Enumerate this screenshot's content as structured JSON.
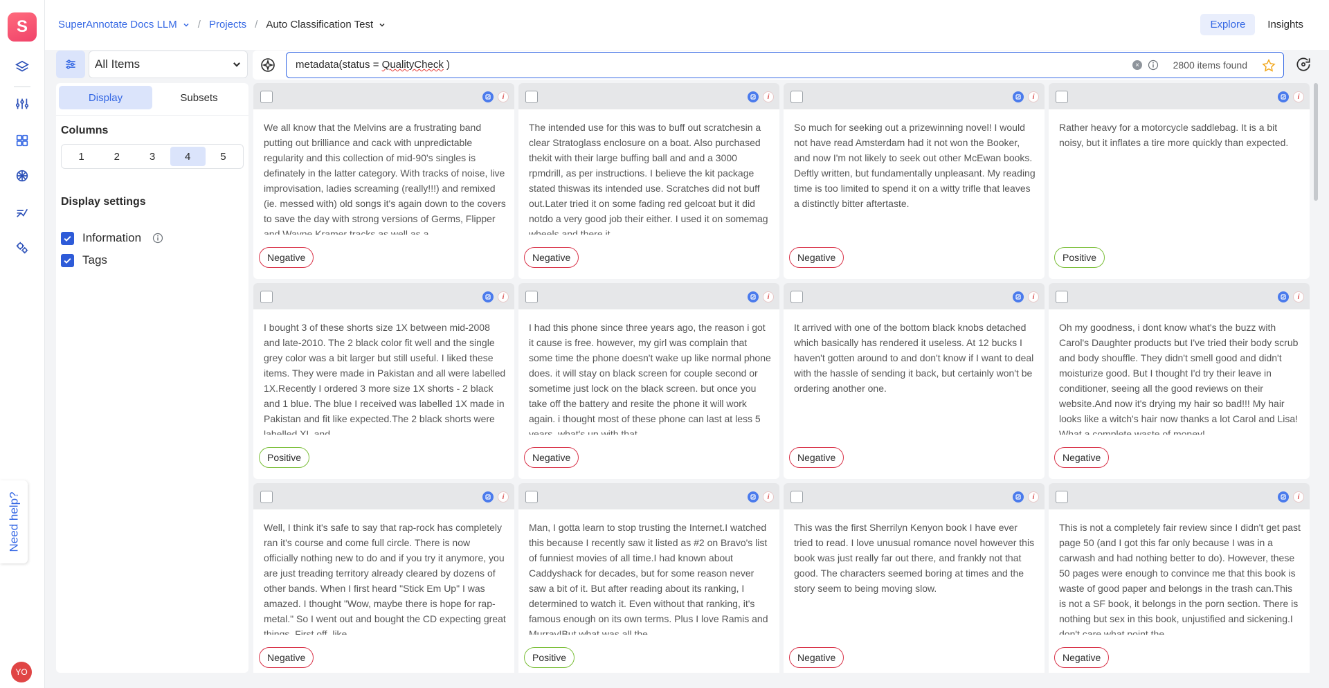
{
  "app": {
    "logo_letter": "S",
    "avatar_initials": "YO",
    "need_help": "Need help?"
  },
  "breadcrumb": {
    "team": "SuperAnnotate Docs LLM",
    "projects": "Projects",
    "project": "Auto Classification Test"
  },
  "top_tabs": {
    "explore": "Explore",
    "insights": "Insights"
  },
  "filter": {
    "selected": "All Items"
  },
  "query": {
    "prefix": "metadata(status = ",
    "misspelled": "QualityCheck",
    "suffix": " )",
    "count": "2800 items found"
  },
  "panel": {
    "tab_display": "Display",
    "tab_subsets": "Subsets",
    "columns_label": "Columns",
    "columns": [
      "1",
      "2",
      "3",
      "4",
      "5"
    ],
    "selected_columns": "4",
    "display_settings_label": "Display settings",
    "information_label": "Information",
    "tags_label": "Tags"
  },
  "colors": {
    "accent": "#3467e4",
    "negative": "#d9344a",
    "positive": "#7cbf3a"
  },
  "cards": [
    {
      "text": "We all know that the Melvins are a frustrating band putting out brilliance and cack with unpredictable regularity and this collection of mid-90's singles is definately in the latter category. With tracks of noise, live improvisation, ladies screaming (really!!!) and remixed (ie. messed with) old songs it's again down to the covers to save the day with strong versions of Germs, Flipper and Wayne Kramer tracks as well as a",
      "tag": "Negative",
      "sentiment": "negative"
    },
    {
      "text": "The intended use for this was to buff out scratchesin a clear Stratoglass enclosure on a boat. Also purchased thekit with their large buffing ball and and a 3000 rpmdrill, as per instructions. I believe the kit package stated thiswas its intended use. Scratches did not buff out.Later tried it on some fading red gelcoat but it did notdo a very good job their either. I used it on somemag wheels and there it",
      "tag": "Negative",
      "sentiment": "negative"
    },
    {
      "text": "So much for seeking out a prizewinning novel! I would not have read Amsterdam had it not won the Booker, and now I'm not likely to seek out other McEwan books. Deftly written, but fundamentally unpleasant. My reading time is too limited to spend it on a witty trifle that leaves a distinctly bitter aftertaste.",
      "tag": "Negative",
      "sentiment": "negative"
    },
    {
      "text": "Rather heavy for a motorcycle saddlebag. It is a bit noisy, but it inflates a tire more quickly than expected.",
      "tag": "Positive",
      "sentiment": "positive"
    },
    {
      "text": "I bought 3 of these shorts size 1X between mid-2008 and late-2010. The 2 black color fit well and the single grey color was a bit larger but still useful. I liked these items. They were made in Pakistan and all were labelled 1X.Recently I ordered 3 more size 1X shorts - 2 black and 1 blue. The blue I received was labelled 1X made in Pakistan and fit like expected.The 2 black shorts were labelled XL and",
      "tag": "Positive",
      "sentiment": "positive"
    },
    {
      "text": "I had this phone since three years ago, the reason i got it cause is free. however, my girl was complain that some time the phone doesn't wake up like normal phone does. it will stay on black screen for couple second or sometime just lock on the black screen. but once you take off the battery and resite the phone it will work again. i thought most of these phone can last at less 5 years, what's up with that.",
      "tag": "Negative",
      "sentiment": "negative"
    },
    {
      "text": "It arrived with one of the bottom black knobs detached which basically has rendered it useless. At 12 bucks I haven't gotten around to and don't know if I want to deal with the hassle of sending it back, but certainly won't be ordering another one.",
      "tag": "Negative",
      "sentiment": "negative"
    },
    {
      "text": "Oh my goodness, i dont know what's the buzz with Carol's Daughter products but I've tried their body scrub and body shouffle. They didn't smell good and didn't moisturize good. But I thought I'd try their leave in conditioner, seeing all the good reviews on their website.And now it's drying my hair so bad!!! My hair looks like a witch's hair now thanks a lot Carol and Lisa! What a complete waste of money!",
      "tag": "Negative",
      "sentiment": "negative"
    },
    {
      "text": "Well, I think it's safe to say that rap-rock has completely ran it's course and come full circle. There is now officially nothing new to do and if you try it anymore, you are just treading territory already cleared by dozens of other bands. When I first heard \"Stick Em Up\" I was amazed. I thought \"Wow, maybe there is hope for rap-metal.\" So I went out and bought the CD expecting great things. First off, like",
      "tag": "Negative",
      "sentiment": "negative"
    },
    {
      "text": "Man, I gotta learn to stop trusting the Internet.I watched this because I recently saw it listed as #2 on Bravo's list of funniest movies of all time.I had known about Caddyshack for decades, but for some reason never saw a bit of it. But after reading about its ranking, I determined to watch it. Even without that ranking, it's famous enough on its own terms. Plus I love Ramis and Murray!But what was all the",
      "tag": "Positive",
      "sentiment": "positive"
    },
    {
      "text": "This was the first Sherrilyn Kenyon book I have ever tried to read. I love unusual romance novel however this book was just really far out there, and frankly not that good. The characters seemed boring at times and the story seem to being moving slow.",
      "tag": "Negative",
      "sentiment": "negative"
    },
    {
      "text": "This is not a completely fair review since I didn't get past page 50 (and I got this far only because I was in a carwash and had nothing better to do). However, these 50 pages were enough to convince me that this book is waste of good paper and belongs in the trash can.This is not a SF book, it belongs in the porn section. There is nothing but sex in this book, unjustified and sickening.I don't care what point the",
      "tag": "Negative",
      "sentiment": "negative"
    }
  ]
}
